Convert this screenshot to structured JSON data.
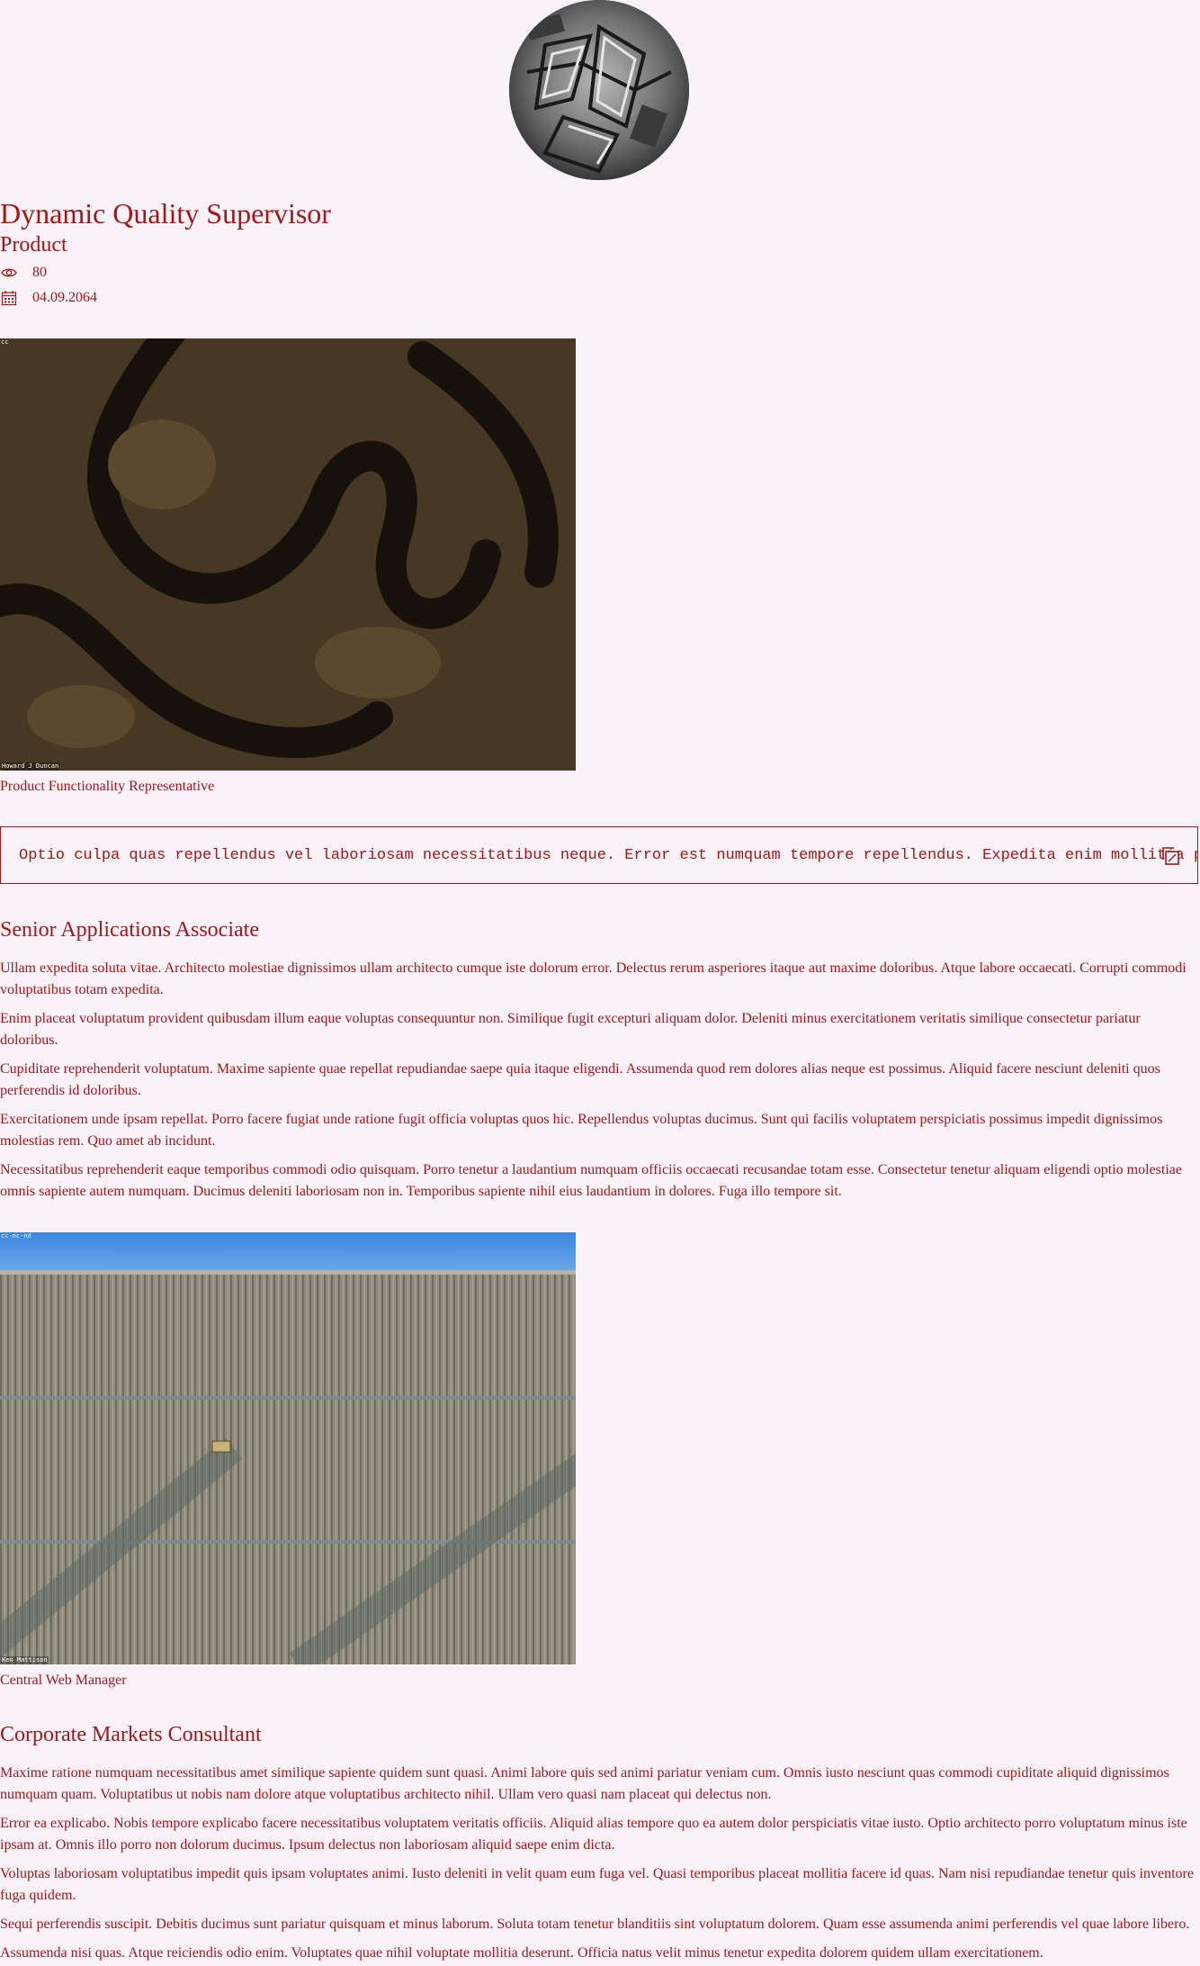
{
  "profile": {
    "title": "Dynamic Quality Supervisor",
    "subtitle": "Product",
    "views": "80",
    "date": "04.09.2064"
  },
  "figures": [
    {
      "license": "cc",
      "credit": "Howard J Duncan",
      "caption": "Product Functionality Representative"
    },
    {
      "license": "cc-nc-nd",
      "credit": "Ken Mattison",
      "caption": "Central Web Manager"
    }
  ],
  "code_block": {
    "text": "Optio culpa quas repellendus vel laboriosam necessitatibus neque. Error est numquam tempore repellendus. Expedita enim mollitia perferendis"
  },
  "sections": [
    {
      "title": "Senior Applications Associate",
      "paragraphs": [
        "Ullam expedita soluta vitae. Architecto molestiae dignissimos ullam architecto cumque iste dolorum error. Delectus rerum asperiores itaque aut maxime doloribus. Atque labore occaecati. Corrupti commodi voluptatibus totam expedita.",
        "Enim placeat voluptatum provident quibusdam illum eaque voluptas consequuntur non. Similique fugit excepturi aliquam dolor. Deleniti minus exercitationem veritatis similique consectetur pariatur doloribus.",
        "Cupiditate reprehenderit voluptatum. Maxime sapiente quae repellat repudiandae saepe quia itaque eligendi. Assumenda quod rem dolores alias neque est possimus. Aliquid facere nesciunt deleniti quos perferendis id doloribus.",
        "Exercitationem unde ipsam repellat. Porro facere fugiat unde ratione fugit officia voluptas quos hic. Repellendus voluptas ducimus. Sunt qui facilis voluptatem perspiciatis possimus impedit dignissimos molestias rem. Quo amet ab incidunt.",
        "Necessitatibus reprehenderit eaque temporibus commodi odio quisquam. Porro tenetur a laudantium numquam officiis occaecati recusandae totam esse. Consectetur tenetur aliquam eligendi optio molestiae omnis sapiente autem numquam. Ducimus deleniti laboriosam non in. Temporibus sapiente nihil eius laudantium in dolores. Fuga illo tempore sit."
      ]
    },
    {
      "title": "Corporate Markets Consultant",
      "paragraphs": [
        "Maxime ratione numquam necessitatibus amet similique sapiente quidem sunt quasi. Animi labore quis sed animi pariatur veniam cum. Omnis iusto nesciunt quas commodi cupiditate aliquid dignissimos numquam quam. Voluptatibus ut nobis nam dolore atque voluptatibus architecto nihil. Ullam vero quasi nam placeat qui delectus non.",
        "Error ea explicabo. Nobis tempore explicabo facere necessitatibus voluptatem veritatis officiis. Aliquid alias tempore quo ea autem dolor perspiciatis vitae iusto. Optio architecto porro voluptatum minus iste ipsam at. Omnis illo porro non dolorum ducimus. Ipsum delectus non laboriosam aliquid saepe enim dicta.",
        "Voluptas laboriosam voluptatibus impedit quis ipsam voluptates animi. Iusto deleniti in velit quam eum fuga vel. Quasi temporibus placeat mollitia facere id quas. Nam nisi repudiandae tenetur quis inventore fuga quidem.",
        "Sequi perferendis suscipit. Debitis ducimus sunt pariatur quisquam et minus laborum. Soluta totam tenetur blanditiis sint voluptatum dolorem. Quam esse assumenda animi perferendis vel quae labore libero.",
        "Assumenda nisi quas. Atque reiciendis odio enim. Voluptates quae nihil voluptate mollitia deserunt. Officia natus velit minus tenetur expedita dolorem quidem ullam exercitationem."
      ]
    }
  ],
  "icons": {
    "views": "eye-icon",
    "date": "calendar-icon",
    "copy": "copy-icon"
  },
  "colors": {
    "text": "#a4161a",
    "background": "#f9f3f8"
  }
}
